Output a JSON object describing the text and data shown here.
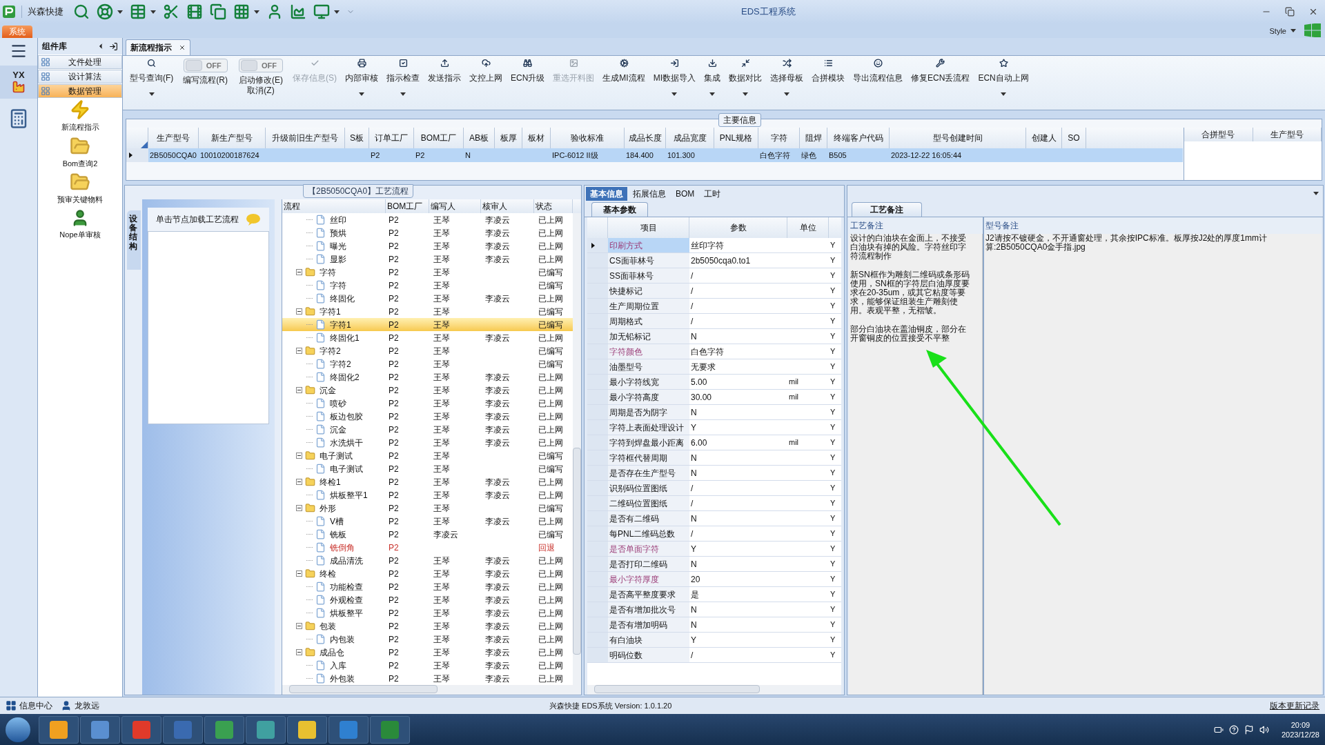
{
  "window": {
    "title": "EDS工程系统",
    "quick_title": "兴森快捷",
    "menu_tab": "系统",
    "style_label": "Style"
  },
  "rail": {
    "logo_text": "YX"
  },
  "sidebar": {
    "title": "组件库",
    "items": [
      {
        "label": "文件处理",
        "selected": false
      },
      {
        "label": "设计算法",
        "selected": false
      },
      {
        "label": "数据管理",
        "selected": true
      }
    ],
    "launchers": [
      {
        "label": "新流程指示",
        "kind": "bolt"
      },
      {
        "label": "Bom查询2",
        "kind": "folder"
      },
      {
        "label": "预审关键物料",
        "kind": "folder"
      },
      {
        "label": "Nope单审核",
        "kind": "person"
      }
    ]
  },
  "doc_tabs": [
    {
      "label": "新流程指示",
      "selected": true
    }
  ],
  "toolbar": [
    {
      "kind": "button",
      "label": "型号查询(F)",
      "dropdown": true,
      "disabled": false
    },
    {
      "kind": "toggle",
      "label": "编写流程(R)",
      "switch_text": "OFF",
      "on": false
    },
    {
      "kind": "toggle",
      "label": "启动修改(E)\n取消(Z)",
      "switch_text": "OFF",
      "on": false
    },
    {
      "kind": "button",
      "label": "保存信息(S)",
      "dropdown": false,
      "disabled": true
    },
    {
      "kind": "button",
      "label": "内部审核",
      "dropdown": true,
      "disabled": false
    },
    {
      "kind": "button",
      "label": "指示检查",
      "dropdown": true,
      "disabled": false
    },
    {
      "kind": "button",
      "label": "发送指示",
      "dropdown": false,
      "disabled": false
    },
    {
      "kind": "button",
      "label": "文控上网",
      "dropdown": false,
      "disabled": false
    },
    {
      "kind": "button",
      "label": "ECN升级",
      "dropdown": false,
      "disabled": false
    },
    {
      "kind": "button",
      "label": "重选开料图",
      "dropdown": false,
      "disabled": true
    },
    {
      "kind": "button",
      "label": "生成MI流程",
      "dropdown": false,
      "disabled": false
    },
    {
      "kind": "button",
      "label": "MI数据导入",
      "dropdown": true,
      "disabled": false
    },
    {
      "kind": "button",
      "label": "集成",
      "dropdown": true,
      "disabled": false
    },
    {
      "kind": "button",
      "label": "数据对比",
      "dropdown": true,
      "disabled": false
    },
    {
      "kind": "button",
      "label": "选择母板",
      "dropdown": true,
      "disabled": false
    },
    {
      "kind": "button",
      "label": "合拼模块",
      "dropdown": false,
      "disabled": false
    },
    {
      "kind": "button",
      "label": "导出流程信息",
      "dropdown": false,
      "disabled": false
    },
    {
      "kind": "button",
      "label": "修复ECN丢流程",
      "dropdown": false,
      "disabled": false
    },
    {
      "kind": "button",
      "label": "ECN自动上网",
      "dropdown": true,
      "disabled": false
    }
  ],
  "main_info": {
    "title": "主要信息",
    "columns": [
      "生产型号",
      "新生产型号",
      "升级前旧生产型号",
      "S板",
      "订单工厂",
      "BOM工厂",
      "AB板",
      "板厚",
      "板材",
      "验收标准",
      "成品长度",
      "成品宽度",
      "PNL规格",
      "字符",
      "阻焊",
      "终端客户代码",
      "型号创建时间",
      "创建人",
      "SO"
    ],
    "rows": [
      {
        "selected": true,
        "cells": [
          "2B5050CQA0",
          "10010200187624",
          "",
          "",
          "P2",
          "P2",
          "N",
          "",
          "",
          "IPC-6012 II级",
          "184.400",
          "101.300",
          "",
          "白色字符",
          "绿色",
          "B505",
          "2023-12-22 16:05:44",
          "",
          ""
        ]
      }
    ],
    "merge_columns": [
      "合拼型号",
      "生产型号"
    ]
  },
  "process": {
    "title": "【2B5050CQA0】工艺流程",
    "side_tab": "设备结构",
    "hint": "单击节点加载工艺流程",
    "columns": [
      "流程",
      "BOM工厂",
      "编写人",
      "核审人",
      "状态"
    ],
    "tree": [
      {
        "children": [
          {
            "label": "丝印",
            "factory": "P2",
            "writer": "王琴",
            "reviewer": "李凌云",
            "status": "已上网",
            "selected": false,
            "flagged": false
          },
          {
            "label": "预烘",
            "factory": "P2",
            "writer": "王琴",
            "reviewer": "李凌云",
            "status": "已上网",
            "selected": false,
            "flagged": false
          },
          {
            "label": "曝光",
            "factory": "P2",
            "writer": "王琴",
            "reviewer": "李凌云",
            "status": "已上网",
            "selected": false,
            "flagged": false
          },
          {
            "label": "显影",
            "factory": "P2",
            "writer": "王琴",
            "reviewer": "李凌云",
            "status": "已上网",
            "selected": false,
            "flagged": false
          }
        ]
      },
      {
        "label": "字符",
        "factory": "P2",
        "writer": "王琴",
        "status": "已编写",
        "selected": false,
        "flagged": false,
        "expanded": true,
        "children": [
          {
            "label": "字符",
            "factory": "P2",
            "writer": "王琴",
            "status": "已编写",
            "selected": false,
            "flagged": false
          },
          {
            "label": "终固化",
            "factory": "P2",
            "writer": "王琴",
            "reviewer": "李凌云",
            "status": "已上网",
            "selected": false,
            "flagged": false
          }
        ]
      },
      {
        "label": "字符1",
        "factory": "P2",
        "writer": "王琴",
        "status": "已编写",
        "selected": false,
        "flagged": false,
        "expanded": true,
        "children": [
          {
            "label": "字符1",
            "factory": "P2",
            "writer": "王琴",
            "status": "已编写",
            "selected": true,
            "flagged": false
          },
          {
            "label": "终固化1",
            "factory": "P2",
            "writer": "王琴",
            "reviewer": "李凌云",
            "status": "已上网",
            "selected": false,
            "flagged": false
          }
        ]
      },
      {
        "label": "字符2",
        "factory": "P2",
        "writer": "王琴",
        "status": "已编写",
        "selected": false,
        "flagged": false,
        "expanded": true,
        "children": [
          {
            "label": "字符2",
            "factory": "P2",
            "writer": "王琴",
            "status": "已编写",
            "selected": false,
            "flagged": false
          },
          {
            "label": "终固化2",
            "factory": "P2",
            "writer": "王琴",
            "reviewer": "李凌云",
            "status": "已上网",
            "selected": false,
            "flagged": false
          }
        ]
      },
      {
        "label": "沉金",
        "factory": "P2",
        "writer": "王琴",
        "reviewer": "李凌云",
        "status": "已上网",
        "selected": false,
        "flagged": false,
        "expanded": true,
        "children": [
          {
            "label": "喷砂",
            "factory": "P2",
            "writer": "王琴",
            "reviewer": "李凌云",
            "status": "已上网",
            "selected": false,
            "flagged": false
          },
          {
            "label": "板边包胶",
            "factory": "P2",
            "writer": "王琴",
            "reviewer": "李凌云",
            "status": "已上网",
            "selected": false,
            "flagged": false
          },
          {
            "label": "沉金",
            "factory": "P2",
            "writer": "王琴",
            "reviewer": "李凌云",
            "status": "已上网",
            "selected": false,
            "flagged": false
          },
          {
            "label": "水洗烘干",
            "factory": "P2",
            "writer": "王琴",
            "reviewer": "李凌云",
            "status": "已上网",
            "selected": false,
            "flagged": false
          }
        ]
      },
      {
        "label": "电子测试",
        "factory": "P2",
        "writer": "王琴",
        "status": "已编写",
        "selected": false,
        "flagged": false,
        "expanded": true,
        "children": [
          {
            "label": "电子测试",
            "factory": "P2",
            "writer": "王琴",
            "status": "已编写",
            "selected": false,
            "flagged": false
          }
        ]
      },
      {
        "label": "终检1",
        "factory": "P2",
        "writer": "王琴",
        "reviewer": "李凌云",
        "status": "已上网",
        "selected": false,
        "flagged": false,
        "expanded": true,
        "children": [
          {
            "label": "烘板整平1",
            "factory": "P2",
            "writer": "王琴",
            "reviewer": "李凌云",
            "status": "已上网",
            "selected": false,
            "flagged": false
          }
        ]
      },
      {
        "label": "外形",
        "factory": "P2",
        "writer": "王琴",
        "status": "已编写",
        "selected": false,
        "flagged": false,
        "expanded": true,
        "children": [
          {
            "label": "V槽",
            "factory": "P2",
            "writer": "王琴",
            "reviewer": "李凌云",
            "status": "已上网",
            "selected": false,
            "flagged": false
          },
          {
            "label": "铣板",
            "factory": "P2",
            "writer": "李凌云",
            "status": "已编写",
            "selected": false,
            "flagged": false
          },
          {
            "label": "铣倒角",
            "factory": "P2",
            "status": "回退",
            "selected": false,
            "flagged": true
          },
          {
            "label": "成品清洗",
            "factory": "P2",
            "writer": "王琴",
            "reviewer": "李凌云",
            "status": "已上网",
            "selected": false,
            "flagged": false
          }
        ]
      },
      {
        "label": "终检",
        "factory": "P2",
        "writer": "王琴",
        "reviewer": "李凌云",
        "status": "已上网",
        "selected": false,
        "flagged": false,
        "expanded": true,
        "children": [
          {
            "label": "功能检查",
            "factory": "P2",
            "writer": "王琴",
            "reviewer": "李凌云",
            "status": "已上网",
            "selected": false,
            "flagged": false
          },
          {
            "label": "外观检查",
            "factory": "P2",
            "writer": "王琴",
            "reviewer": "李凌云",
            "status": "已上网",
            "selected": false,
            "flagged": false
          },
          {
            "label": "烘板整平",
            "factory": "P2",
            "writer": "王琴",
            "reviewer": "李凌云",
            "status": "已上网",
            "selected": false,
            "flagged": false
          }
        ]
      },
      {
        "label": "包装",
        "factory": "P2",
        "writer": "王琴",
        "reviewer": "李凌云",
        "status": "已上网",
        "selected": false,
        "flagged": false,
        "expanded": true,
        "children": [
          {
            "label": "内包装",
            "factory": "P2",
            "writer": "王琴",
            "reviewer": "李凌云",
            "status": "已上网",
            "selected": false,
            "flagged": false
          }
        ]
      },
      {
        "label": "成品仓",
        "factory": "P2",
        "writer": "王琴",
        "reviewer": "李凌云",
        "status": "已上网",
        "selected": false,
        "flagged": false,
        "expanded": true,
        "children": [
          {
            "label": "入库",
            "factory": "P2",
            "writer": "王琴",
            "reviewer": "李凌云",
            "status": "已上网",
            "selected": false,
            "flagged": false
          },
          {
            "label": "外包装",
            "factory": "P2",
            "writer": "王琴",
            "reviewer": "李凌云",
            "status": "已上网",
            "selected": false,
            "flagged": false
          }
        ]
      }
    ]
  },
  "params": {
    "tabs": [
      {
        "label": "基本信息",
        "selected": true
      },
      {
        "label": "拓展信息",
        "selected": false
      },
      {
        "label": "BOM",
        "selected": false
      },
      {
        "label": "工时",
        "selected": false
      }
    ],
    "sub_tab": "基本参数",
    "columns": [
      "项目",
      "参数",
      "单位"
    ],
    "rows": [
      {
        "item": "印刷方式",
        "value": "丝印字符",
        "flag": "Y",
        "marked": true,
        "selected": true
      },
      {
        "item": "CS面菲林号",
        "value": "2b5050cqa0.to1",
        "flag": "Y",
        "marked": false,
        "selected": false
      },
      {
        "item": "SS面菲林号",
        "value": "/",
        "flag": "Y",
        "marked": false,
        "selected": false
      },
      {
        "item": "快捷标记",
        "value": "/",
        "flag": "Y",
        "marked": false,
        "selected": false
      },
      {
        "item": "生产周期位置",
        "value": "/",
        "flag": "Y",
        "marked": false,
        "selected": false
      },
      {
        "item": "周期格式",
        "value": "/",
        "flag": "Y",
        "marked": false,
        "selected": false
      },
      {
        "item": "加无铅标记",
        "value": "N",
        "flag": "Y",
        "marked": false,
        "selected": false
      },
      {
        "item": "字符颜色",
        "value": "白色字符",
        "flag": "Y",
        "marked": true,
        "selected": false
      },
      {
        "item": "油墨型号",
        "value": "无要求",
        "flag": "Y",
        "marked": false,
        "selected": false
      },
      {
        "item": "最小字符线宽",
        "value": "5.00",
        "unit": "mil",
        "flag": "Y",
        "marked": false,
        "selected": false
      },
      {
        "item": "最小字符高度",
        "value": "30.00",
        "unit": "mil",
        "flag": "Y",
        "marked": false,
        "selected": false
      },
      {
        "item": "周期是否为阴字",
        "value": "N",
        "flag": "Y",
        "marked": false,
        "selected": false
      },
      {
        "item": "字符上表面处理设计",
        "value": "Y",
        "flag": "Y",
        "marked": false,
        "selected": false
      },
      {
        "item": "字符到焊盘最小距离",
        "value": "6.00",
        "unit": "mil",
        "flag": "Y",
        "marked": false,
        "selected": false
      },
      {
        "item": "字符框代替周期",
        "value": "N",
        "flag": "Y",
        "marked": false,
        "selected": false
      },
      {
        "item": "是否存在生产型号",
        "value": "N",
        "flag": "Y",
        "marked": false,
        "selected": false
      },
      {
        "item": "识别码位置图纸",
        "value": "/",
        "flag": "Y",
        "marked": false,
        "selected": false
      },
      {
        "item": "二维码位置图纸",
        "value": "/",
        "flag": "Y",
        "marked": false,
        "selected": false
      },
      {
        "item": "是否有二维码",
        "value": "N",
        "flag": "Y",
        "marked": false,
        "selected": false
      },
      {
        "item": "每PNL二维码总数",
        "value": "/",
        "flag": "Y",
        "marked": false,
        "selected": false
      },
      {
        "item": "是否单面字符",
        "value": "Y",
        "flag": "Y",
        "marked": true,
        "selected": false
      },
      {
        "item": "是否打印二维码",
        "value": "N",
        "flag": "Y",
        "marked": false,
        "selected": false
      },
      {
        "item": "最小字符厚度",
        "value": "20",
        "flag": "Y",
        "marked": true,
        "selected": false
      },
      {
        "item": "是否高平整度要求",
        "value": "是",
        "flag": "Y",
        "marked": false,
        "selected": false
      },
      {
        "item": "是否有增加批次号",
        "value": "N",
        "flag": "Y",
        "marked": false,
        "selected": false
      },
      {
        "item": "是否有增加明码",
        "value": "N",
        "flag": "Y",
        "marked": false,
        "selected": false
      },
      {
        "item": "有白油块",
        "value": "Y",
        "flag": "Y",
        "marked": false,
        "selected": false
      },
      {
        "item": "明码位数",
        "value": "/",
        "flag": "Y",
        "marked": false,
        "selected": false
      }
    ]
  },
  "notes": {
    "tab": "工艺备注",
    "columns": [
      "工艺备注",
      "型号备注"
    ],
    "process_note": [
      "设计的白油块在金面上，不接受白油块有掉的风险。字符丝印字符流程制作",
      "新SN框作为雕刻二维码或条形码使用，SN框的字符层白油厚度要求在20-35um，或其它粘度等要求，能够保证组装生产雕刻使用。表观平整，无褶皱。",
      "部分白油块在盖油铜皮，部分在开窗铜皮的位置接受不平整"
    ],
    "model_note": "J2请按不镀硬金，不开通窗处理，其余按IPC标准。板厚按J2处的厚度1mm计算:2B5050CQA0金手指.jpg"
  },
  "status_bar": {
    "items": [
      {
        "label": "信息中心",
        "kind": "grid"
      },
      {
        "label": "龙敦远",
        "kind": "person"
      }
    ],
    "version": "兴森快捷 EDS系统 Version: 1.0.1.20",
    "link": "版本更新记录"
  },
  "taskbar": {
    "time": "20:09",
    "date": "2023/12/28"
  }
}
